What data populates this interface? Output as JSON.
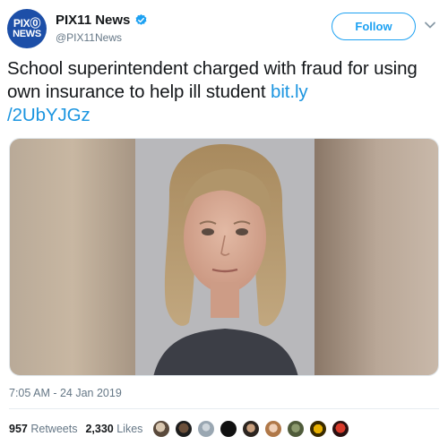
{
  "account": {
    "logo_line1": "PIX⓪",
    "logo_line2": "NEWS",
    "display_name": "PIX11 News",
    "handle": "@PIX11News"
  },
  "header": {
    "follow_label": "Follow"
  },
  "tweet": {
    "text": "School superintendent charged with fraud for using own insurance to help ill student ",
    "link_line1": "bit.ly",
    "link_line2": "/2UbYJGz",
    "timestamp": "7:05 AM - 24 Jan 2019"
  },
  "stats": {
    "retweets_count": "957",
    "retweets_label": "Retweets",
    "likes_count": "2,330",
    "likes_label": "Likes"
  },
  "colors": {
    "accent": "#1da1f2",
    "link": "#1b95e0",
    "muted": "#657786",
    "logo_bg": "#1d4fa8"
  },
  "icons": [
    "verified-badge-icon",
    "chevron-down-icon"
  ]
}
